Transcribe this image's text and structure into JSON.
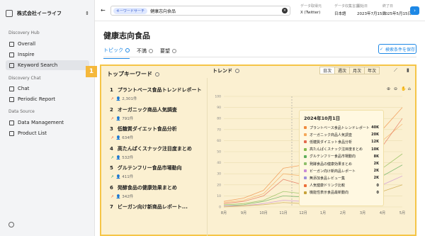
{
  "sidebar": {
    "org_name": "株式会社イーライフ",
    "sections": {
      "discovery_hub": "Discovery Hub",
      "discovery_chat": "Discovery Chat",
      "data_source": "Data Source"
    },
    "items": [
      {
        "label": "Overall"
      },
      {
        "label": "Inspire"
      },
      {
        "label": "Keyword Search"
      },
      {
        "label": "Chat"
      },
      {
        "label": "Periodic Report"
      },
      {
        "label": "Data Management"
      },
      {
        "label": "Product List"
      }
    ]
  },
  "topbar": {
    "chip": "キーワードサーチ",
    "query": "健康志向食品",
    "fields": [
      {
        "label": "データ取得元",
        "value": "X (Twitter)"
      },
      {
        "label": "データ収集言語",
        "value": "日本語"
      },
      {
        "label": "開始日",
        "value": "2023年7月15日"
      },
      {
        "label": "終了日",
        "value": "2025年5月15日"
      }
    ]
  },
  "page": {
    "title": "健康志向食品",
    "tabs": [
      "トピック",
      "不満",
      "要望"
    ],
    "save_button": "検索条件を保存"
  },
  "callout_number": "1",
  "top_keywords": {
    "title": "トップキーワード",
    "items": [
      {
        "rank": "1",
        "name": "プラントベース食品トレンドレポート",
        "count": "2,301件",
        "trend": "up"
      },
      {
        "rank": "2",
        "name": "オーガニック商品人気調査",
        "count": "791件",
        "trend": "up"
      },
      {
        "rank": "3",
        "name": "低糖質ダイエット食品分析",
        "count": "634件",
        "trend": "up"
      },
      {
        "rank": "4",
        "name": "高たんぱくスナック注目度まとめ",
        "count": "532件",
        "trend": "flat"
      },
      {
        "rank": "5",
        "name": "グルテンフリー食品市場動向",
        "count": "411件",
        "trend": "flat"
      },
      {
        "rank": "6",
        "name": "発酵食品の健康効果まとめ",
        "count": "342件",
        "trend": "up"
      },
      {
        "rank": "7",
        "name": "ビーガン向け新商品レポート...",
        "count": "",
        "trend": "up"
      }
    ]
  },
  "trend": {
    "title": "トレンド",
    "granularity": [
      "日次",
      "週次",
      "月次",
      "年次"
    ],
    "active_granularity": "日次",
    "tooltip": {
      "date": "2024年10月1日",
      "rows": [
        {
          "label": "プラントベース食品トレンドレポート",
          "value": "40K",
          "color": "#ef8a3d"
        },
        {
          "label": "オーガニック商品人気調査",
          "value": "20K",
          "color": "#f4a85a"
        },
        {
          "label": "低糖質ダイエット食品分析",
          "value": "12K",
          "color": "#e36a4f"
        },
        {
          "label": "高たんぱくスナック注目度まとめ",
          "value": "10K",
          "color": "#86b94c"
        },
        {
          "label": "グルテンフリー食品市場動向",
          "value": "8K",
          "color": "#5fae5b"
        },
        {
          "label": "発酵食品の健康効果まとめ",
          "value": "2K",
          "color": "#8fbf6a"
        },
        {
          "label": "ビーガン向け新商品レポート",
          "value": "2K",
          "color": "#c98bd6"
        },
        {
          "label": "無添加食品レビュー集",
          "value": "2K",
          "color": "#9c8fd9"
        },
        {
          "label": "人気健康ドリンク比較",
          "value": "0",
          "color": "#ec6e3a"
        },
        {
          "label": "機能性表示食品最新動向",
          "value": "0",
          "color": "#c7a23a"
        }
      ]
    }
  },
  "chart_data": {
    "type": "line",
    "categories": [
      "8月",
      "9月",
      "10月",
      "11月",
      "12月",
      "1月",
      "2月",
      "3月",
      "4月",
      "5月"
    ],
    "ylim": [
      0,
      100
    ],
    "y_ticks": [
      "0",
      "10",
      "20",
      "30",
      "40",
      "50",
      "60",
      "70",
      "80",
      "90",
      "100"
    ],
    "series": [
      {
        "color": "#ef8a3d",
        "values": [
          5,
          8,
          15,
          35,
          38,
          45,
          52,
          58,
          70,
          90
        ]
      },
      {
        "color": "#f4a85a",
        "values": [
          4,
          6,
          12,
          30,
          28,
          35,
          40,
          50,
          60,
          75
        ]
      },
      {
        "color": "#e36a4f",
        "values": [
          3,
          5,
          10,
          25,
          20,
          30,
          38,
          45,
          55,
          80
        ]
      },
      {
        "color": "#86b94c",
        "values": [
          2,
          3,
          6,
          14,
          12,
          18,
          25,
          30,
          35,
          48
        ]
      },
      {
        "color": "#5fae5b",
        "values": [
          1,
          2,
          5,
          10,
          9,
          14,
          18,
          22,
          28,
          38
        ]
      },
      {
        "color": "#c98bd6",
        "values": [
          1,
          1,
          3,
          6,
          5,
          9,
          12,
          16,
          20,
          28
        ]
      },
      {
        "color": "#c7a23a",
        "values": [
          0,
          1,
          2,
          4,
          3,
          6,
          9,
          12,
          14,
          20
        ]
      }
    ]
  }
}
